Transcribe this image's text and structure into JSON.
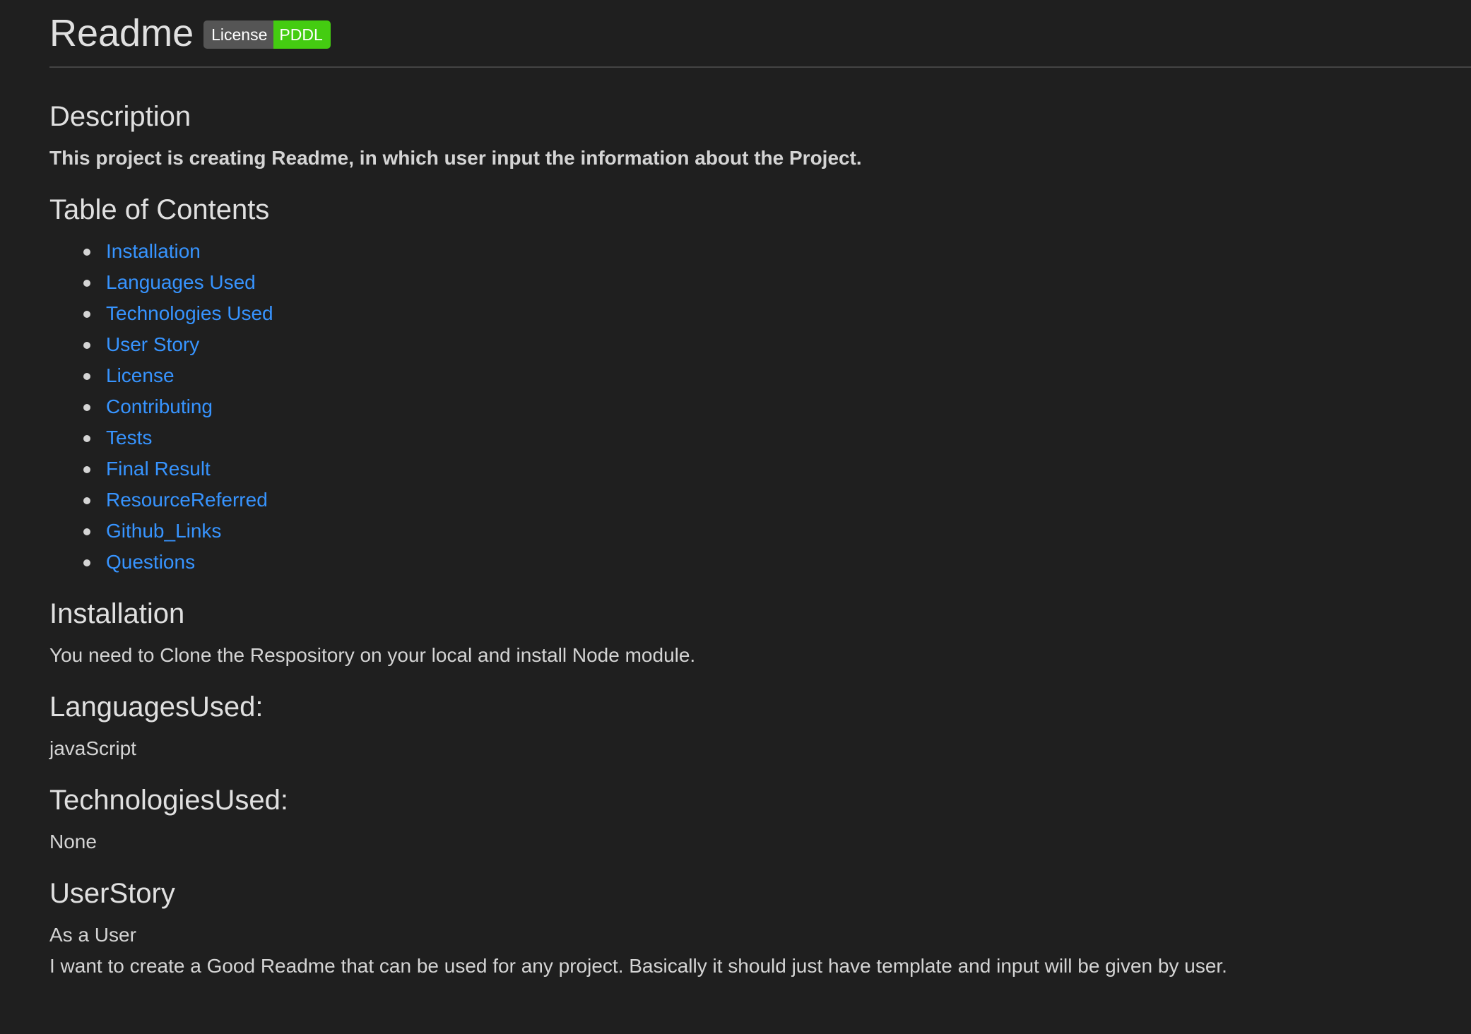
{
  "header": {
    "title": "Readme",
    "badge_label": "License",
    "badge_value": "PDDL"
  },
  "colors": {
    "background": "#1f1f1f",
    "link": "#3794ff",
    "badge_left": "#555555",
    "badge_right": "#44cc11"
  },
  "description": {
    "heading": "Description",
    "text": "This project is creating Readme, in which user input the information about the Project."
  },
  "toc": {
    "heading": "Table of Contents",
    "items": [
      "Installation",
      "Languages Used",
      "Technologies Used",
      "User Story",
      "License",
      "Contributing",
      "Tests",
      "Final Result",
      "ResourceReferred",
      "Github_Links",
      "Questions"
    ]
  },
  "installation": {
    "heading": "Installation",
    "text": "You need to Clone the Respository on your local and install Node module."
  },
  "languages": {
    "heading": "LanguagesUsed:",
    "text": "javaScript"
  },
  "technologies": {
    "heading": "TechnologiesUsed:",
    "text": "None"
  },
  "user_story": {
    "heading": "UserStory",
    "line1": "As a User",
    "line2": "I want to create a Good Readme that can be used for any project. Basically it should just have template and input will be given by user."
  }
}
